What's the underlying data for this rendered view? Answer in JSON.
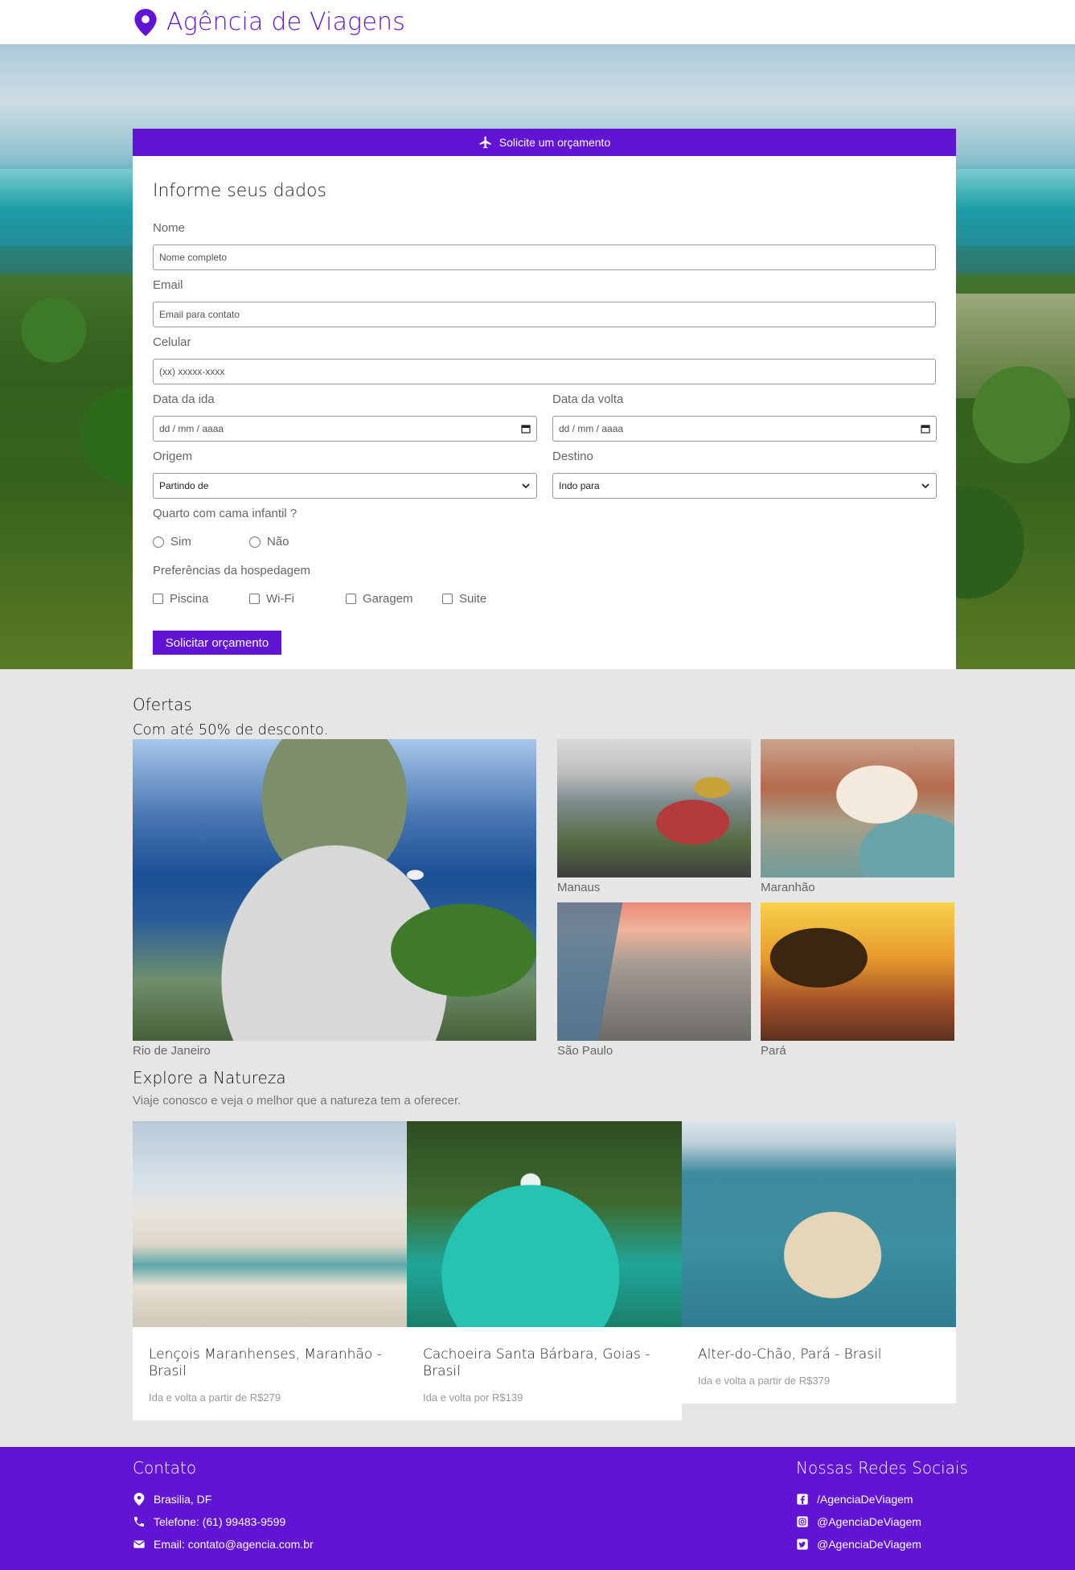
{
  "header": {
    "title": "Agência de Viagens"
  },
  "quote_form": {
    "banner": "Solicite um orçamento",
    "title": "Informe seus dados",
    "name_label": "Nome",
    "name_placeholder": "Nome completo",
    "email_label": "Email",
    "email_placeholder": "Email para contato",
    "phone_label": "Celular",
    "phone_placeholder": "(xx) xxxxx-xxxx",
    "depart_label": "Data da ida",
    "depart_value": "dd / mm / aaaa",
    "return_label": "Data da volta",
    "return_value": "dd / mm / aaaa",
    "origin_label": "Origem",
    "origin_value": "Partindo de",
    "dest_label": "Destino",
    "dest_value": "Indo para",
    "crib_label": "Quarto com cama infantil ?",
    "crib_options": [
      "Sim",
      "Não"
    ],
    "prefs_label": "Preferências da hospedagem",
    "prefs_options": [
      "Piscina",
      "Wi-Fi",
      "Garagem",
      "Suite"
    ],
    "submit": "Solicitar orçamento"
  },
  "offers": {
    "title": "Ofertas",
    "subtitle": "Com até 50% de desconto.",
    "items": [
      "Rio de Janeiro",
      "Manaus",
      "Maranhão",
      "São Paulo",
      "Pará"
    ]
  },
  "nature": {
    "title": "Explore a Natureza",
    "subtitle": "Viaje conosco e veja o melhor que a natureza tem a oferecer.",
    "items": [
      {
        "name": "Lençois Maranhenses, Maranhão - Brasil",
        "price": "Ida e volta a partir de R$279"
      },
      {
        "name": "Cachoeira Santa Bárbara, Goias - Brasil",
        "price": "Ida e volta por R$139"
      },
      {
        "name": "Alter-do-Chão, Pará - Brasil",
        "price": "Ida e volta a partir de R$379"
      }
    ]
  },
  "footer": {
    "contact_title": "Contato",
    "address": "Brasilia, DF",
    "phone": "Telefone: (61) 99483-9599",
    "email": "Email: contato@agencia.com.br",
    "social_title": "Nossas Redes Sociais",
    "facebook": "/AgenciaDeViagem",
    "instagram": "@AgenciaDeViagem",
    "twitter": "@AgenciaDeViagem"
  },
  "colors": {
    "accent": "#6214d5",
    "background": "#e6e6e6"
  },
  "icons": [
    "map-pin-icon",
    "plane-icon",
    "calendar-icon",
    "chevron-down-icon",
    "phone-icon",
    "envelope-icon",
    "facebook-icon",
    "instagram-icon",
    "twitter-icon"
  ]
}
